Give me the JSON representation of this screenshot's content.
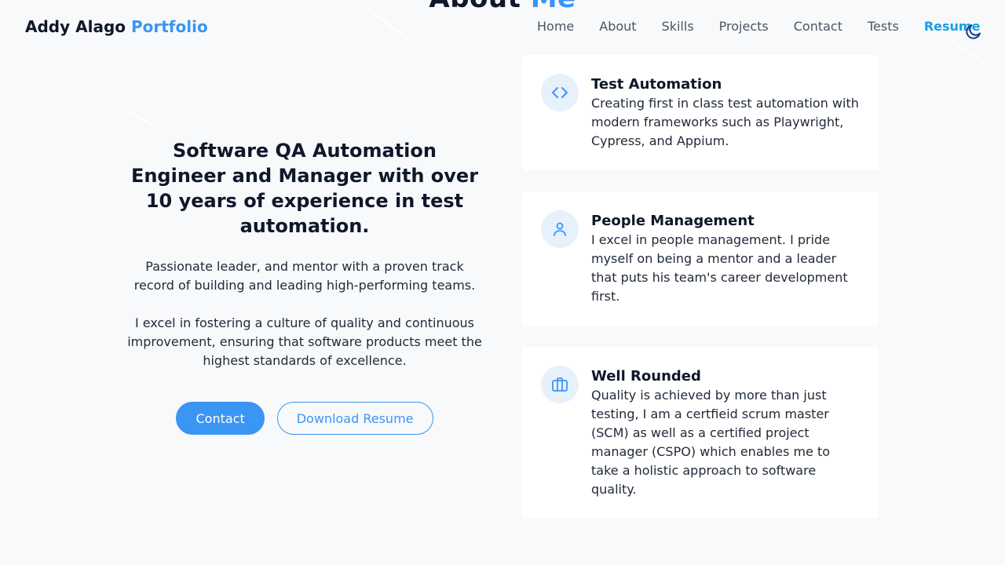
{
  "header": {
    "brand_name": "Addy Alago",
    "brand_accent": "Portfolio",
    "nav": [
      {
        "label": "Home"
      },
      {
        "label": "About"
      },
      {
        "label": "Skills"
      },
      {
        "label": "Projects"
      },
      {
        "label": "Contact"
      },
      {
        "label": "Tests"
      },
      {
        "label": "Resume"
      }
    ],
    "active_nav": "Resume",
    "theme_toggle_icon": "moon-icon"
  },
  "section": {
    "title_main": "About",
    "title_accent": "Me"
  },
  "intro": {
    "headline": "Software QA Automation Engineer and Manager with over 10 years of experience in test automation.",
    "paragraph_1": "Passionate leader, and mentor with a proven track record of building and leading high-performing teams.",
    "paragraph_2": "I excel in fostering a culture of quality and continuous improvement, ensuring that software products meet the highest standards of excellence.",
    "contact_button": "Contact",
    "resume_button": "Download Resume"
  },
  "cards": [
    {
      "icon": "code-icon",
      "title": "Test Automation",
      "text": "Creating first in class test automation with modern frameworks such as Playwright, Cypress, and Appium."
    },
    {
      "icon": "user-icon",
      "title": "People Management",
      "text": "I excel in people management. I pride myself on being a mentor and a leader that puts his team's career development first."
    },
    {
      "icon": "briefcase-icon",
      "title": "Well Rounded",
      "text": "Quality is achieved by more than just testing, I am a certfieid scrum master (SCM) as well as a certified project manager (CSPO) which enables me to take a holistic approach to software quality."
    }
  ],
  "colors": {
    "accent": "#3b95f2",
    "active_nav": "#14a0e8",
    "text_dark": "#0f172a",
    "background": "#f7f9fb",
    "icon_bg": "#e6f1fc"
  }
}
